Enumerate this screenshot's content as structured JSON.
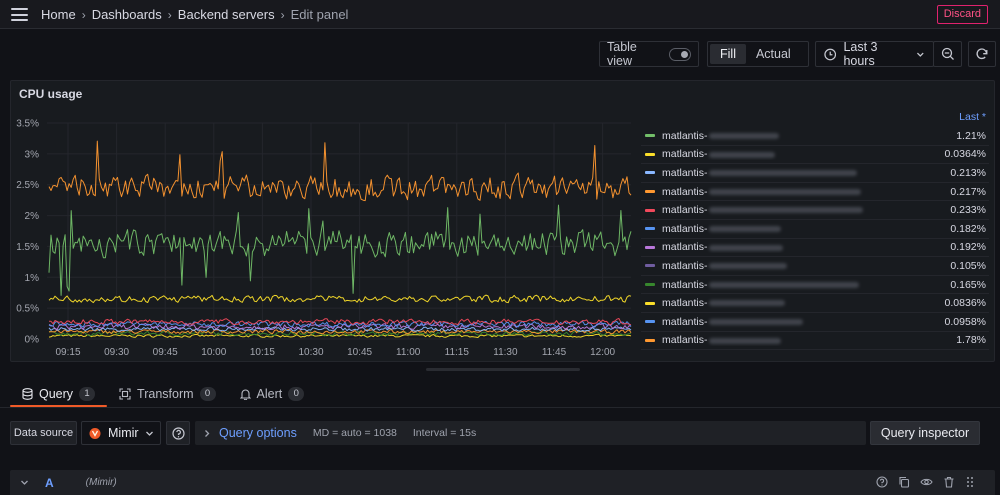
{
  "breadcrumb": {
    "items": [
      "Home",
      "Dashboards",
      "Backend servers"
    ],
    "current": "Edit panel",
    "separator": "›"
  },
  "header": {
    "discard_label": "Discard"
  },
  "toolbar": {
    "table_view_label": "Table view",
    "table_view_on": false,
    "fill_label": "Fill",
    "actual_label": "Actual",
    "time_range_label": "Last 3 hours"
  },
  "panel": {
    "title": "CPU usage",
    "legend_header": "Last *",
    "legend": [
      {
        "name": "matlantis-",
        "value": "1.21%",
        "color": "#73bf69"
      },
      {
        "name": "matlantis-",
        "value": "0.0364%",
        "color": "#fade2a"
      },
      {
        "name": "matlantis-",
        "value": "0.213%",
        "color": "#8ab8ff"
      },
      {
        "name": "matlantis-",
        "value": "0.217%",
        "color": "#ff9830"
      },
      {
        "name": "matlantis-",
        "value": "0.233%",
        "color": "#f2495c"
      },
      {
        "name": "matlantis-",
        "value": "0.182%",
        "color": "#5794f2"
      },
      {
        "name": "matlantis-",
        "value": "0.192%",
        "color": "#b877d9"
      },
      {
        "name": "matlantis-",
        "value": "0.105%",
        "color": "#705da0"
      },
      {
        "name": "matlantis-",
        "value": "0.165%",
        "color": "#37872d"
      },
      {
        "name": "matlantis-",
        "value": "0.0836%",
        "color": "#fade2a"
      },
      {
        "name": "matlantis-",
        "value": "0.0958%",
        "color": "#5794f2"
      },
      {
        "name": "matlantis-",
        "value": "1.78%",
        "color": "#ff9830"
      }
    ]
  },
  "chart_data": {
    "type": "line",
    "title": "CPU usage",
    "y_ticks": [
      "3.5%",
      "3%",
      "2.5%",
      "2%",
      "1.5%",
      "1%",
      "0.5%",
      "0%"
    ],
    "x_ticks": [
      "09:15",
      "09:30",
      "09:45",
      "10:00",
      "10:15",
      "10:30",
      "10:45",
      "11:00",
      "11:15",
      "11:30",
      "11:45",
      "12:00"
    ],
    "ylim": [
      0,
      3.5
    ],
    "y_unit": "%",
    "grid": true,
    "legend_position": "right",
    "series": [
      {
        "name": "matlantis-",
        "color": "#ff9830",
        "level": 2.45,
        "noise": 0.18,
        "spike": 3.25
      },
      {
        "name": "matlantis-",
        "color": "#73bf69",
        "level": 1.55,
        "noise": 0.2,
        "spike": 2.2,
        "dip": 0.7
      },
      {
        "name": "matlantis-",
        "color": "#fade2a",
        "level": 0.65,
        "noise": 0.05
      },
      {
        "name": "matlantis-",
        "color": "#f2495c",
        "level": 0.28,
        "noise": 0.04
      },
      {
        "name": "matlantis-",
        "color": "#5794f2",
        "level": 0.24,
        "noise": 0.04
      },
      {
        "name": "matlantis-",
        "color": "#b877d9",
        "level": 0.2,
        "noise": 0.04
      },
      {
        "name": "matlantis-",
        "color": "#8ab8ff",
        "level": 0.16,
        "noise": 0.03
      },
      {
        "name": "matlantis-",
        "color": "#ff9830",
        "level": 0.12,
        "noise": 0.03
      },
      {
        "name": "matlantis-",
        "color": "#37872d",
        "level": 0.09,
        "noise": 0.03
      },
      {
        "name": "matlantis-",
        "color": "#fade2a",
        "level": 0.05,
        "noise": 0.02
      }
    ]
  },
  "tabs": [
    {
      "label": "Query",
      "count": "1",
      "active": true
    },
    {
      "label": "Transform",
      "count": "0",
      "active": false
    },
    {
      "label": "Alert",
      "count": "0",
      "active": false
    }
  ],
  "query": {
    "data_source_label": "Data source",
    "data_source_value": "Mimir",
    "options_title": "Query options",
    "options_md": "MD = auto = 1038",
    "options_interval": "Interval = 15s",
    "inspector_label": "Query inspector",
    "row_letter": "A",
    "row_datasource": "(Mimir)"
  }
}
